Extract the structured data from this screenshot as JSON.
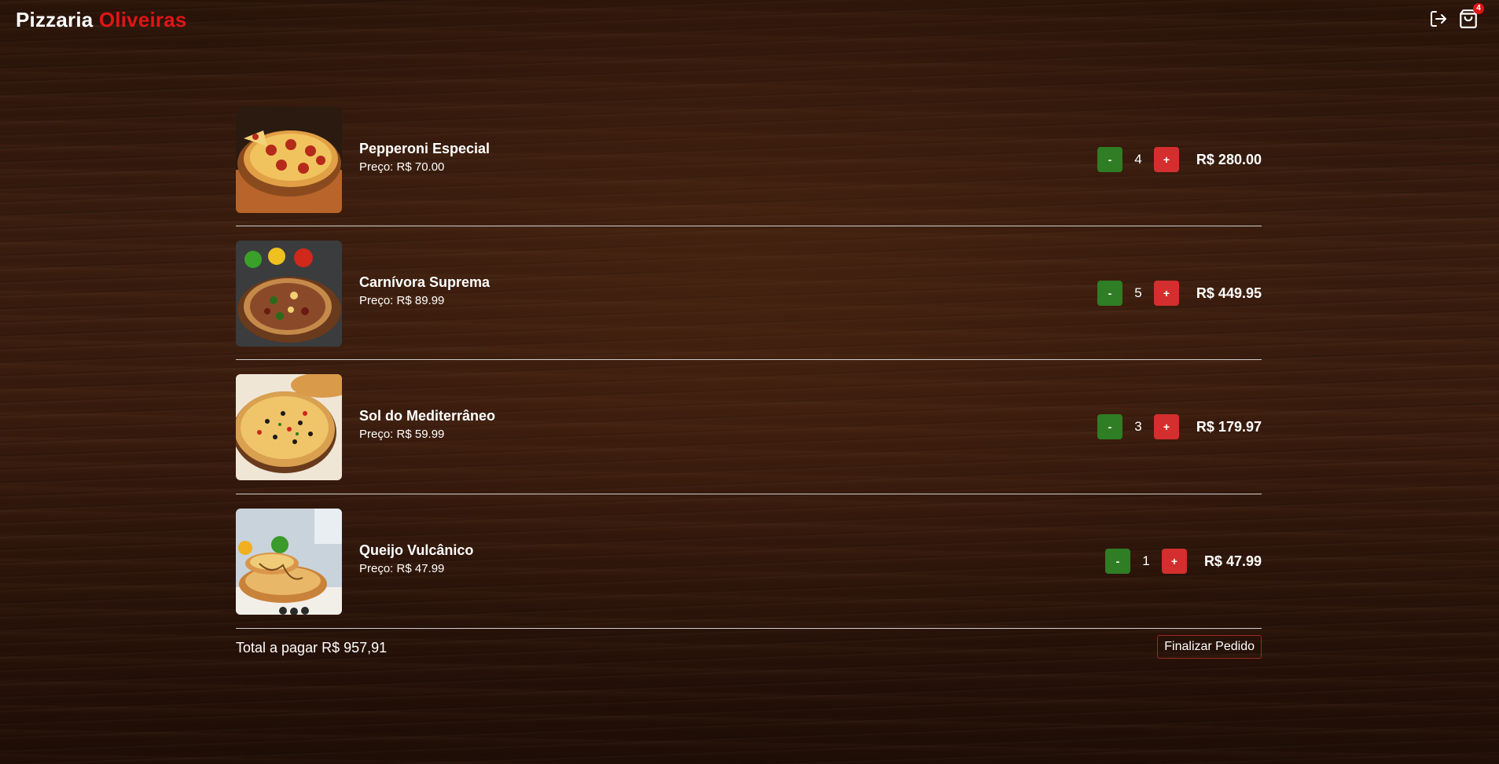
{
  "header": {
    "brand_primary": "Pizzaria",
    "brand_accent": "Oliveiras",
    "accent_color": "#e11515",
    "logout_icon": "logout-icon",
    "bag_icon": "shopping-bag-icon",
    "cart_count": "4"
  },
  "cart": {
    "items": [
      {
        "name": "Pepperoni Especial",
        "price": "Preço: R$ 70.00",
        "quantity": "4",
        "minus_label": "-",
        "plus_label": "+",
        "total": "R$ 280.00"
      },
      {
        "name": "Carnívora Suprema",
        "price": "Preço: R$ 89.99",
        "quantity": "5",
        "minus_label": "-",
        "plus_label": "+",
        "total": "R$ 449.95"
      },
      {
        "name": "Sol do Mediterrâneo",
        "price": "Preço: R$ 59.99",
        "quantity": "3",
        "minus_label": "-",
        "plus_label": "+",
        "total": "R$ 179.97"
      },
      {
        "name": "Queijo Vulcânico",
        "price": "Preço: R$ 47.99",
        "quantity": "1",
        "minus_label": "-",
        "plus_label": "+",
        "total": "R$ 47.99"
      }
    ]
  },
  "footer": {
    "total_label": "Total a pagar R$ 957,91",
    "finish_button": "Finalizar Pedido"
  },
  "colors": {
    "minus_button": "#2f7d24",
    "plus_button": "#d42e2e",
    "background": "#2a140a"
  }
}
